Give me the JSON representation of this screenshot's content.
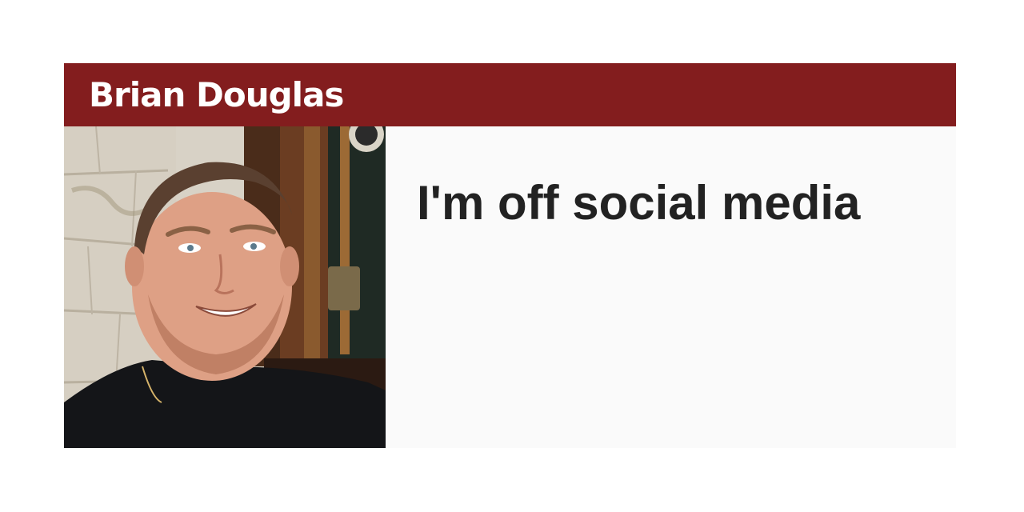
{
  "card": {
    "author_name": "Brian Douglas",
    "headline": "I'm off social media",
    "photo_icon": "author-portrait-photo"
  },
  "colors": {
    "header_background": "#831d1e",
    "header_text": "#ffffff",
    "panel_background": "#fafafa",
    "headline_text": "#222222"
  }
}
